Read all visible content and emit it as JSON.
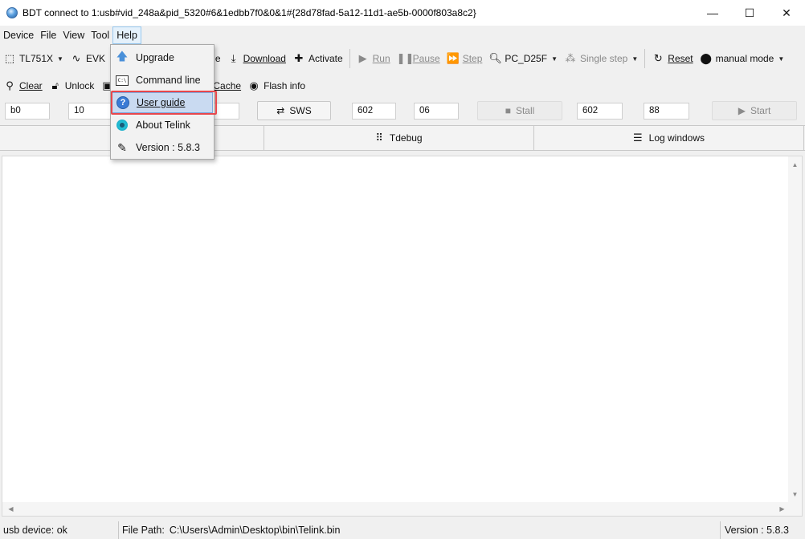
{
  "window": {
    "title": "BDT connect to 1:usb#vid_248a&pid_5320#6&1edbb7f0&0&1#{28d78fad-5a12-11d1-ae5b-0000f803a8c2}",
    "minimize": "—",
    "maximize": "☐",
    "close": "✕"
  },
  "menu": [
    "Device",
    "File",
    "View",
    "Tool",
    "Help"
  ],
  "toolbar1": {
    "chip": "TL751X",
    "board": "EVK",
    "partial_label": "e",
    "download": "Download",
    "activate": "Activate",
    "run": "Run",
    "pause": "Pause",
    "step": "Step",
    "pc": "PC_D25F",
    "single_step": "Single step",
    "reset": "Reset",
    "mode": "manual mode"
  },
  "toolbar2": {
    "clear": "Clear",
    "unlock": "Unlock",
    "cache": "Cache",
    "flash_info": "Flash info"
  },
  "inputs": {
    "f1": "b0",
    "f2": "10",
    "sws": "SWS",
    "f4": "602",
    "f5": "06",
    "stall": "Stall",
    "f6": "602",
    "f7": "88",
    "start": "Start"
  },
  "tabs": [
    "Tdebug",
    "Log windows"
  ],
  "help_menu": [
    {
      "label": "Upgrade",
      "icon": "upgrade-arrow-icon"
    },
    {
      "label": "Command line",
      "icon": "command-line-icon"
    },
    {
      "label": "User guide",
      "icon": "help-circle-icon"
    },
    {
      "label": "About Telink",
      "icon": "telink-logo-icon"
    },
    {
      "label": "Version : 5.8.3",
      "icon": "pencil-icon"
    }
  ],
  "status": {
    "device": "usb device: ok",
    "file_path_label": "File Path:",
    "file_path": "C:\\Users\\Admin\\Desktop\\bin\\Telink.bin",
    "version": "Version : 5.8.3"
  },
  "colors": {
    "highlight": "#e8474c",
    "hover": "#c9daf1",
    "accent": "#3a7bd5"
  }
}
